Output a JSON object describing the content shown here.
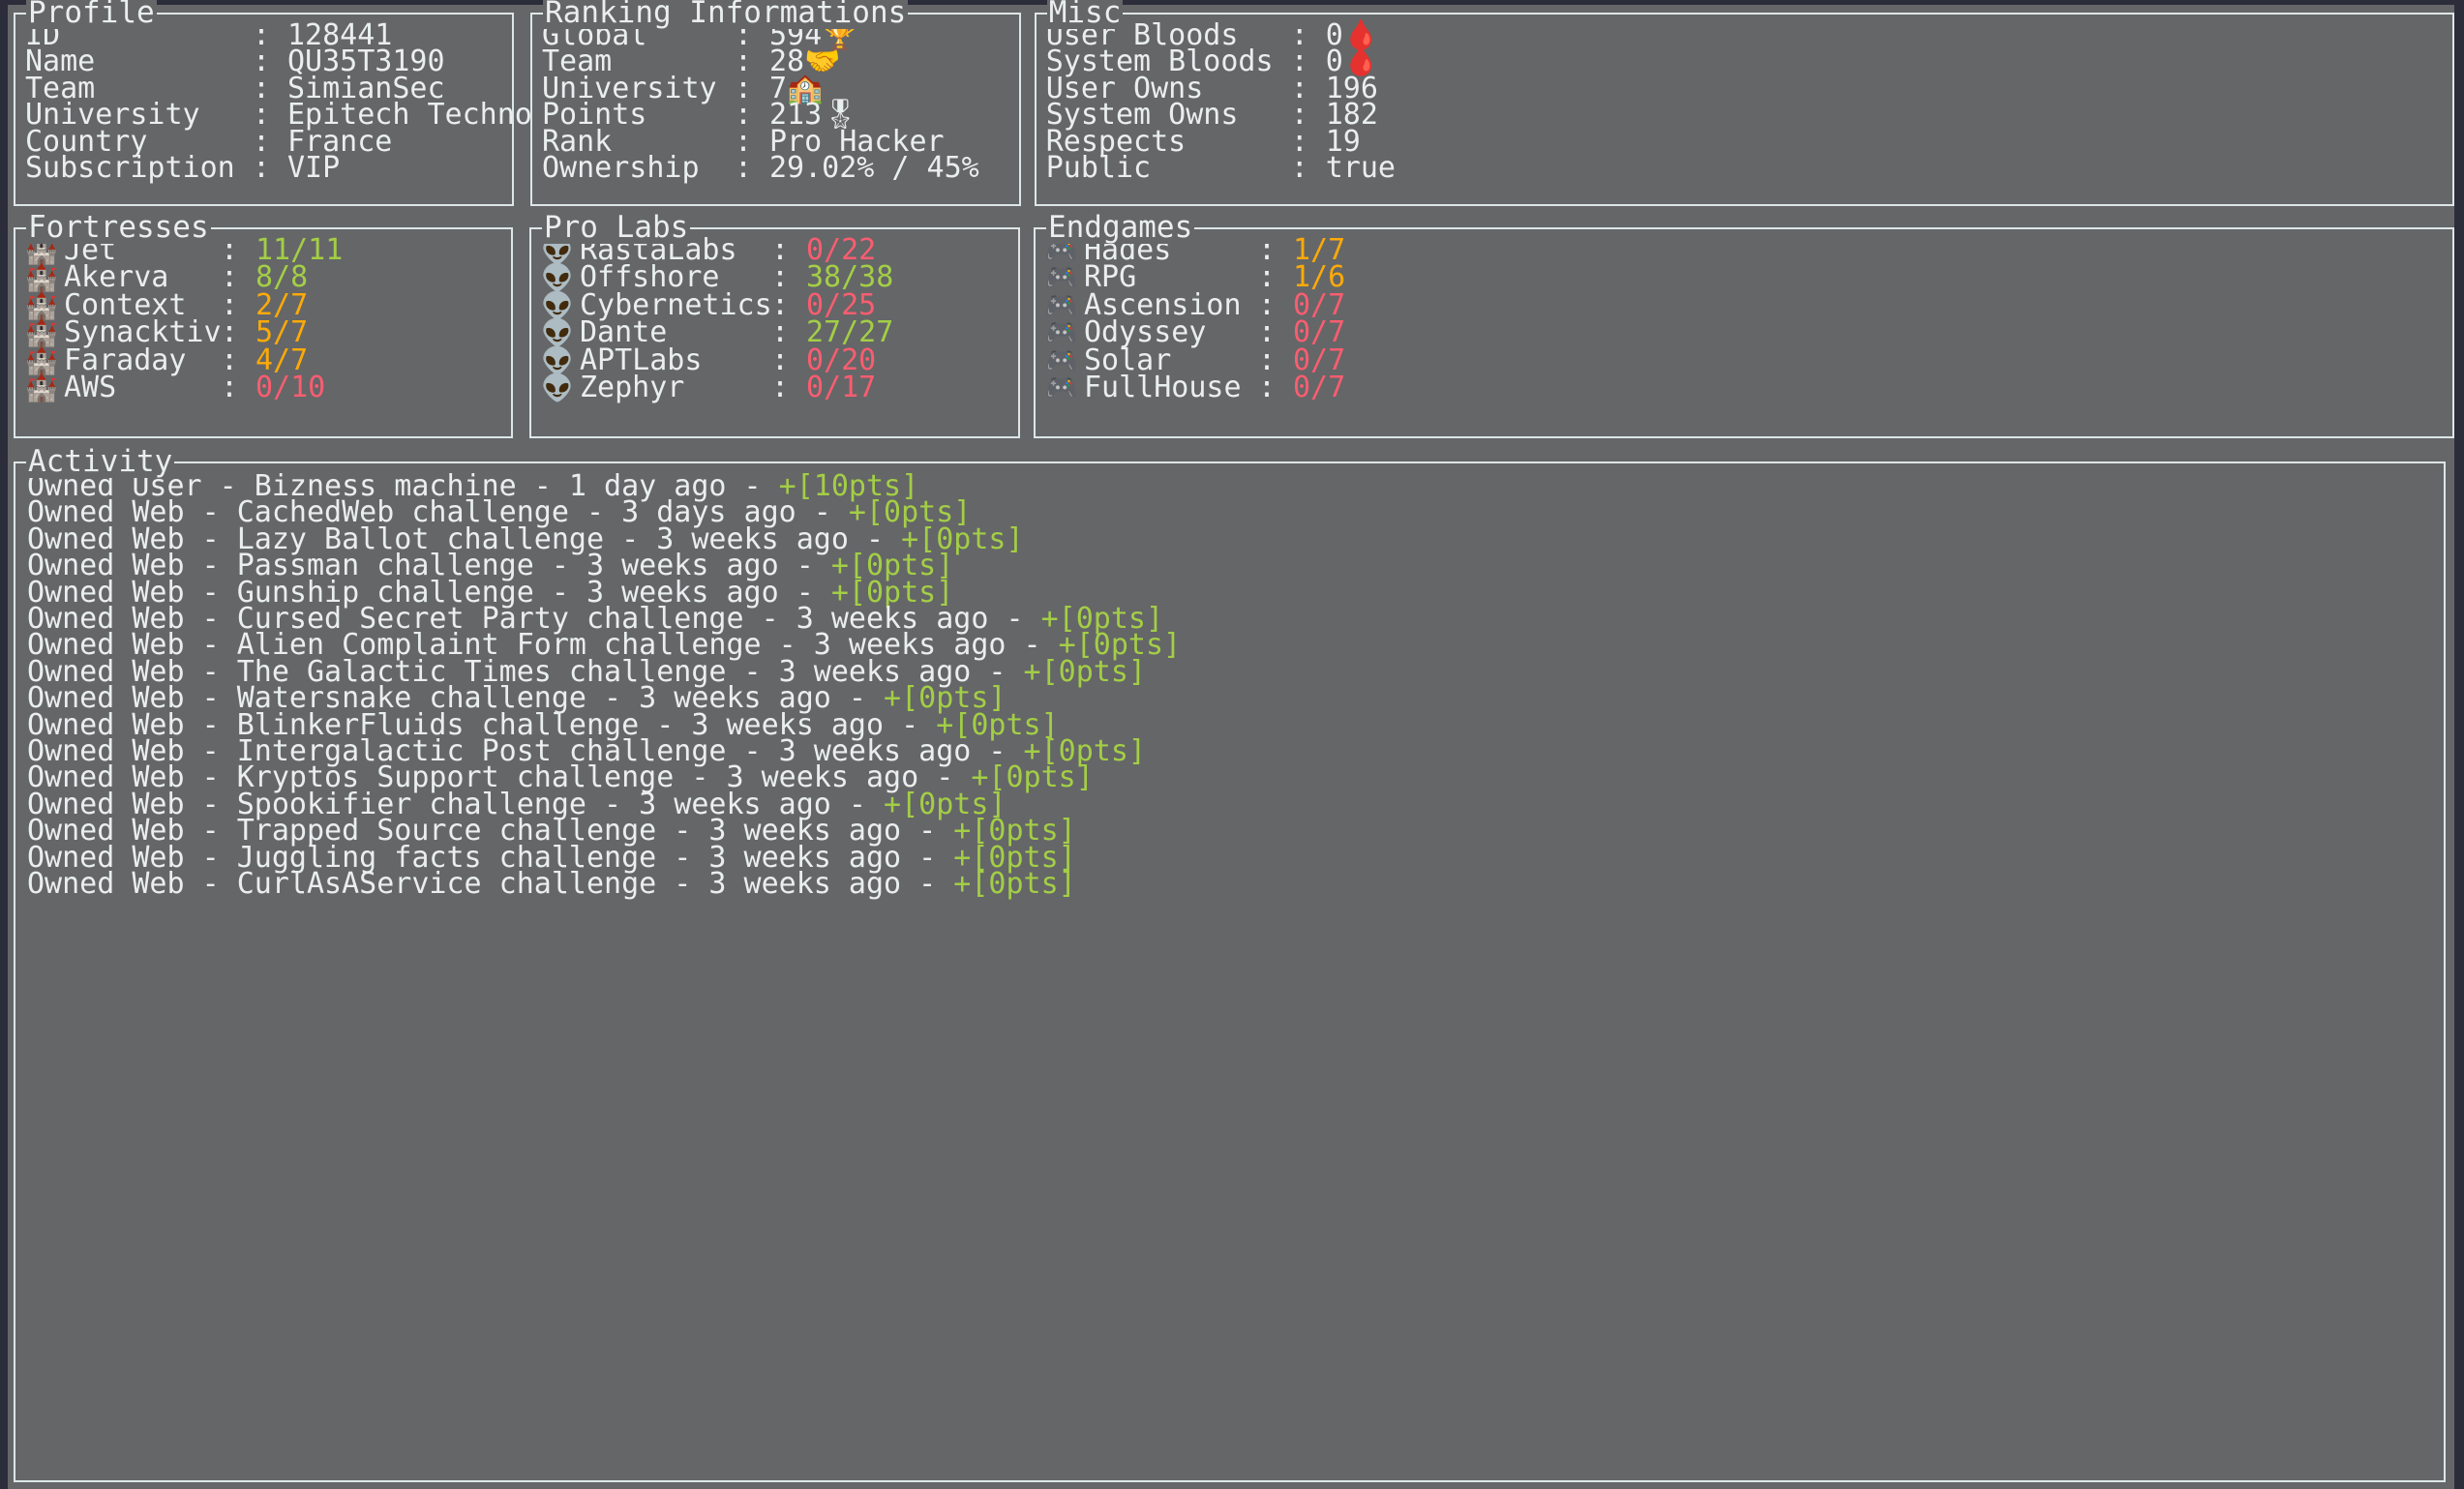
{
  "theme": {
    "background": "#656668",
    "shell": "#2b2d3a",
    "border": "#dde6e6",
    "text": "#e9eeee",
    "green": "#a3ce46",
    "orange": "#fcaa08",
    "red": "#f95d70"
  },
  "panels": {
    "profile": {
      "title": "Profile",
      "rows": [
        {
          "key": "ID",
          "sep": ":",
          "value": "128441"
        },
        {
          "key": "Name",
          "sep": ":",
          "value": "QU35T3190"
        },
        {
          "key": "Team",
          "sep": ":",
          "value": "SimianSec"
        },
        {
          "key": "University",
          "sep": ":",
          "value": "Epitech Technology"
        },
        {
          "key": "Country",
          "sep": ":",
          "value": "France"
        },
        {
          "key": "Subscription",
          "sep": ":",
          "value": "VIP"
        }
      ]
    },
    "ranking": {
      "title": "Ranking Informations",
      "rows": [
        {
          "key": "Global",
          "sep": ":",
          "value": "594",
          "icon": "🏆",
          "icon_name": "trophy-icon"
        },
        {
          "key": "Team",
          "sep": ":",
          "value": "28",
          "icon": "🤝",
          "icon_name": "handshake-icon"
        },
        {
          "key": "University",
          "sep": ":",
          "value": "7",
          "icon": "🏫",
          "icon_name": "school-icon"
        },
        {
          "key": "Points",
          "sep": ":",
          "value": "213",
          "icon": "🎖",
          "icon_name": "medal-icon"
        },
        {
          "key": "Rank",
          "sep": ":",
          "value": "Pro Hacker",
          "icon": "",
          "icon_name": ""
        },
        {
          "key": "Ownership",
          "sep": ":",
          "value": "29.02% / 45%",
          "icon": "",
          "icon_name": ""
        }
      ]
    },
    "misc": {
      "title": "Misc",
      "rows": [
        {
          "key": "User Bloods",
          "sep": ":",
          "value": "0",
          "icon": "🩸",
          "icon_name": "blood-drop-icon"
        },
        {
          "key": "System Bloods",
          "sep": ":",
          "value": "0",
          "icon": "🩸",
          "icon_name": "blood-drop-icon"
        },
        {
          "key": "User Owns",
          "sep": ":",
          "value": "196",
          "icon": "",
          "icon_name": ""
        },
        {
          "key": "System Owns",
          "sep": ":",
          "value": "182",
          "icon": "",
          "icon_name": ""
        },
        {
          "key": "Respects",
          "sep": ":",
          "value": "19",
          "icon": "",
          "icon_name": ""
        },
        {
          "key": "Public",
          "sep": ":",
          "value": "true",
          "icon": "",
          "icon_name": ""
        }
      ]
    },
    "fortresses": {
      "title": "Fortresses",
      "icon": "🏰",
      "icon_name": "castle-icon",
      "rows": [
        {
          "key": "Jet",
          "sep": ":",
          "value": "11/11",
          "color": "green"
        },
        {
          "key": "Akerva",
          "sep": ":",
          "value": "8/8",
          "color": "green"
        },
        {
          "key": "Context",
          "sep": ":",
          "value": "2/7",
          "color": "orange"
        },
        {
          "key": "Synacktiv",
          "sep": ":",
          "value": "5/7",
          "color": "orange"
        },
        {
          "key": "Faraday",
          "sep": ":",
          "value": "4/7",
          "color": "orange"
        },
        {
          "key": "AWS",
          "sep": ":",
          "value": "0/10",
          "color": "red"
        }
      ]
    },
    "prolabs": {
      "title": "Pro Labs",
      "icon": "👽",
      "icon_name": "alien-icon",
      "rows": [
        {
          "key": "RastaLabs",
          "sep": ":",
          "value": "0/22",
          "color": "red"
        },
        {
          "key": "Offshore",
          "sep": ":",
          "value": "38/38",
          "color": "green"
        },
        {
          "key": "Cybernetics",
          "sep": ":",
          "value": "0/25",
          "color": "red"
        },
        {
          "key": "Dante",
          "sep": ":",
          "value": "27/27",
          "color": "green"
        },
        {
          "key": "APTLabs",
          "sep": ":",
          "value": "0/20",
          "color": "red"
        },
        {
          "key": "Zephyr",
          "sep": ":",
          "value": "0/17",
          "color": "red"
        }
      ]
    },
    "endgames": {
      "title": "Endgames",
      "icon": "🎮",
      "icon_name": "game-controller-icon",
      "rows": [
        {
          "key": "Hades",
          "sep": ":",
          "value": "1/7",
          "color": "orange"
        },
        {
          "key": "RPG",
          "sep": ":",
          "value": "1/6",
          "color": "orange"
        },
        {
          "key": "Ascension",
          "sep": ":",
          "value": "0/7",
          "color": "red"
        },
        {
          "key": "Odyssey",
          "sep": ":",
          "value": "0/7",
          "color": "red"
        },
        {
          "key": "Solar",
          "sep": ":",
          "value": "0/7",
          "color": "red"
        },
        {
          "key": "FullHouse",
          "sep": ":",
          "value": "0/7",
          "color": "red"
        }
      ]
    },
    "activity": {
      "title": "Activity",
      "rows": [
        {
          "text": "Owned User - Bizness machine - 1 day ago - ",
          "points": "+[10pts]"
        },
        {
          "text": "Owned Web - CachedWeb challenge - 3 days ago - ",
          "points": "+[0pts]"
        },
        {
          "text": "Owned Web - Lazy Ballot challenge - 3 weeks ago - ",
          "points": "+[0pts]"
        },
        {
          "text": "Owned Web - Passman challenge - 3 weeks ago - ",
          "points": "+[0pts]"
        },
        {
          "text": "Owned Web - Gunship challenge - 3 weeks ago - ",
          "points": "+[0pts]"
        },
        {
          "text": "Owned Web - Cursed Secret Party challenge - 3 weeks ago - ",
          "points": "+[0pts]"
        },
        {
          "text": "Owned Web - Alien Complaint Form challenge - 3 weeks ago - ",
          "points": "+[0pts]"
        },
        {
          "text": "Owned Web - The Galactic Times challenge - 3 weeks ago - ",
          "points": "+[0pts]"
        },
        {
          "text": "Owned Web - Watersnake challenge - 3 weeks ago - ",
          "points": "+[0pts]"
        },
        {
          "text": "Owned Web - BlinkerFluids challenge - 3 weeks ago - ",
          "points": "+[0pts]"
        },
        {
          "text": "Owned Web - Intergalactic Post challenge - 3 weeks ago - ",
          "points": "+[0pts]"
        },
        {
          "text": "Owned Web - Kryptos Support challenge - 3 weeks ago - ",
          "points": "+[0pts]"
        },
        {
          "text": "Owned Web - Spookifier challenge - 3 weeks ago - ",
          "points": "+[0pts]"
        },
        {
          "text": "Owned Web - Trapped Source challenge - 3 weeks ago - ",
          "points": "+[0pts]"
        },
        {
          "text": "Owned Web - Juggling facts challenge - 3 weeks ago - ",
          "points": "+[0pts]"
        },
        {
          "text": "Owned Web - CurlAsAService challenge - 3 weeks ago - ",
          "points": "+[0pts]"
        }
      ]
    }
  }
}
